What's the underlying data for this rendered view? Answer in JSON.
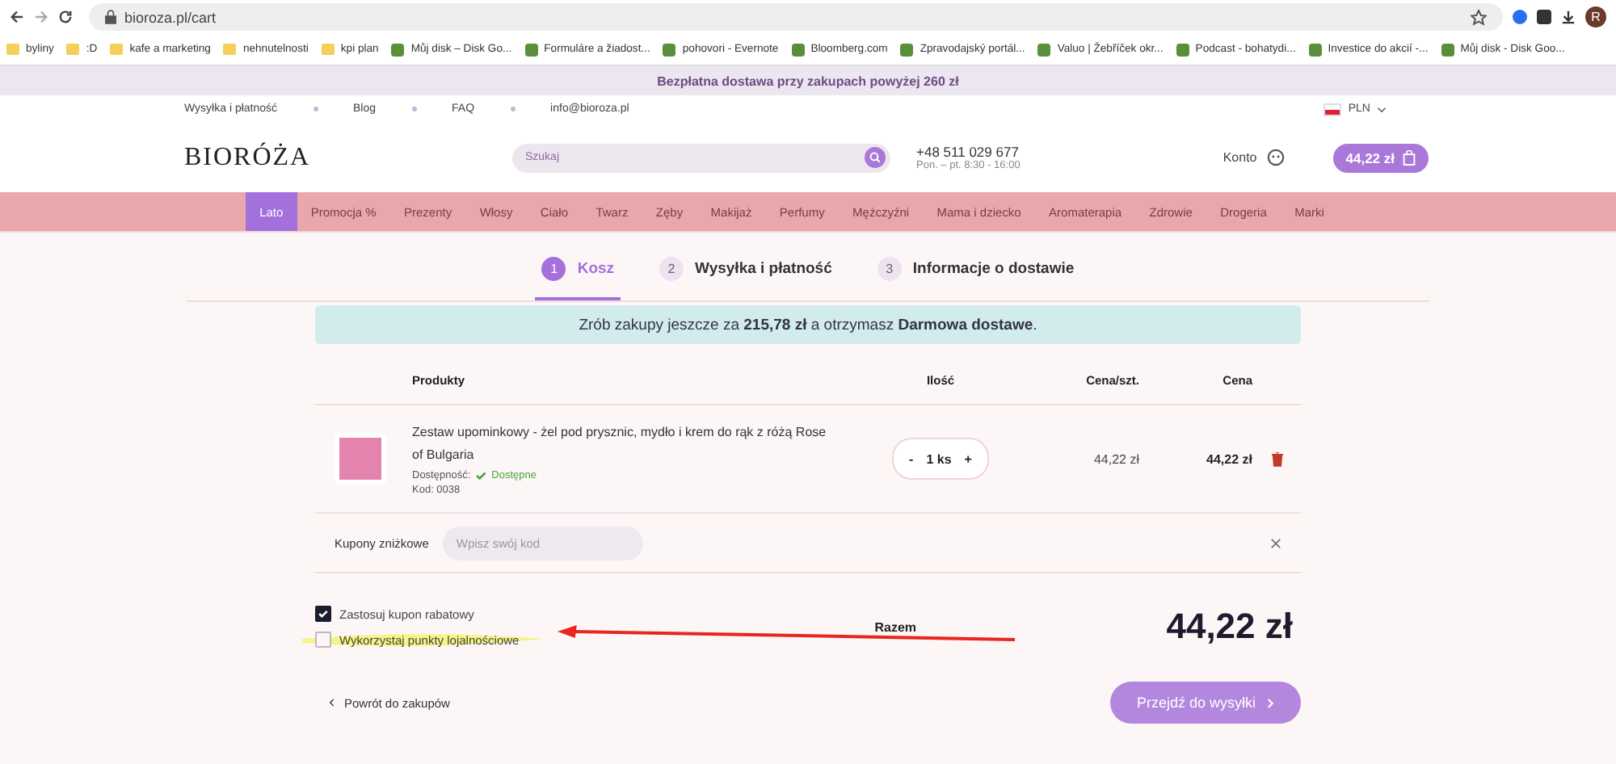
{
  "browser": {
    "url": "bioroza.pl/cart",
    "bookmarks": [
      {
        "label": "byliny",
        "kind": "folder"
      },
      {
        "label": ":D",
        "kind": "folder"
      },
      {
        "label": "kafe a marketing",
        "kind": "folder"
      },
      {
        "label": "nehnutelnosti",
        "kind": "folder"
      },
      {
        "label": "kpi plan",
        "kind": "folder"
      },
      {
        "label": "Můj disk – Disk Go...",
        "kind": "site"
      },
      {
        "label": "Formuláre a žiadost...",
        "kind": "site"
      },
      {
        "label": "pohovori - Evernote",
        "kind": "site"
      },
      {
        "label": "Bloomberg.com",
        "kind": "site"
      },
      {
        "label": "Zpravodajský portál...",
        "kind": "site"
      },
      {
        "label": "Valuo | Žebříček okr...",
        "kind": "site"
      },
      {
        "label": "Podcast - bohatydi...",
        "kind": "site"
      },
      {
        "label": "Investice do akcií -...",
        "kind": "site"
      },
      {
        "label": "Můj disk - Disk Goo...",
        "kind": "site"
      }
    ],
    "profile_initial": "R"
  },
  "promo_bar": {
    "text": "Bezpłatna dostawa przy zakupach powyżej 260 zł"
  },
  "top_links": [
    "Wysyłka i płatność",
    "Blog",
    "FAQ",
    "info@bioroza.pl"
  ],
  "currency": "PLN",
  "header": {
    "logo": "BIORÓŻA",
    "search_placeholder": "Szukaj",
    "phone": "+48 511 029 677",
    "hours": "Pon. – pt. 8:30 - 16:00",
    "account": "Konto",
    "cart_total": "44,22 zł"
  },
  "nav": [
    {
      "label": "Lato",
      "selected": true
    },
    {
      "label": "Promocja %",
      "selected": false
    },
    {
      "label": "Prezenty",
      "selected": false
    },
    {
      "label": "Włosy",
      "selected": false
    },
    {
      "label": "Ciało",
      "selected": false
    },
    {
      "label": "Twarz",
      "selected": false
    },
    {
      "label": "Zęby",
      "selected": false
    },
    {
      "label": "Makijaż",
      "selected": false
    },
    {
      "label": "Perfumy",
      "selected": false
    },
    {
      "label": "Mężczyźni",
      "selected": false
    },
    {
      "label": "Mama i dziecko",
      "selected": false
    },
    {
      "label": "Aromaterapia",
      "selected": false
    },
    {
      "label": "Zdrowie",
      "selected": false
    },
    {
      "label": "Drogeria",
      "selected": false
    },
    {
      "label": "Marki",
      "selected": false
    }
  ],
  "steps": [
    {
      "number": "1",
      "label": "Kosz",
      "selected": true
    },
    {
      "number": "2",
      "label": "Wysyłka i płatność",
      "selected": false
    },
    {
      "number": "3",
      "label": "Informacje o dostawie",
      "selected": false
    }
  ],
  "notice": "Zrób zakupy jeszcze za **215,78 zł** a otrzymasz **Darmowa dostawe**.",
  "table": {
    "columns": [
      "Produkty",
      "Ilość",
      "Cena/szt.",
      "Cena"
    ],
    "rows": [
      {
        "name": "Zestaw upominkowy - żel pod prysznic, mydło i krem do rąk z różą Rose of Bulgaria",
        "availability_label": "Dostępność:",
        "availability": "Dostępne",
        "code": "Kod: 0038",
        "quantity": "1 ks",
        "minus": "-",
        "plus": "+",
        "unit_price": "44,22 zł",
        "price": "44,22 zł"
      }
    ]
  },
  "coupon": {
    "label": "Kupony zniżkowe",
    "placeholder": "Wpisz swój kod"
  },
  "options": [
    {
      "label": "Zastosuj kupon rabatowy",
      "checked": true
    },
    {
      "label": "Wykorzystaj punkty lojalnościowe",
      "checked": false
    }
  ],
  "total_label": "Razem",
  "total": "44,22 zł",
  "back_link": "Powrót do zakupów",
  "next_button": "Przejdź do wysyłki"
}
